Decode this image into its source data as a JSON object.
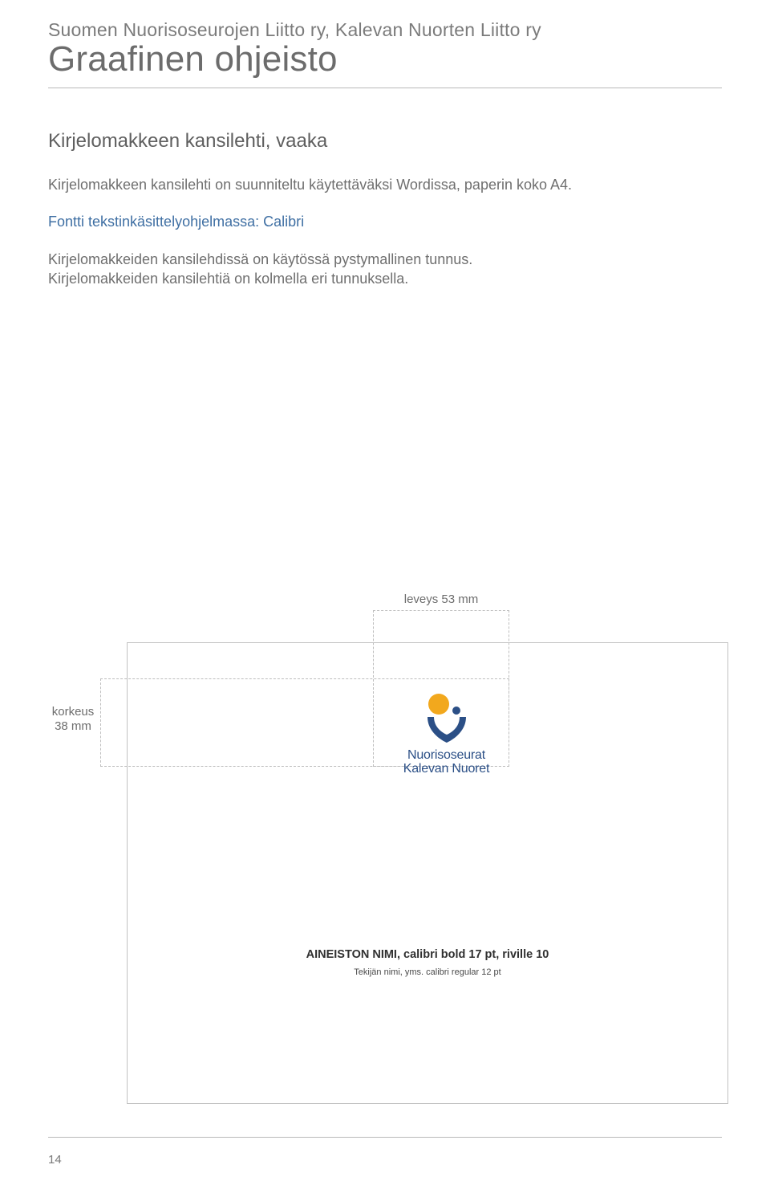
{
  "header": {
    "org": "Suomen Nuorisoseurojen Liitto ry, Kalevan Nuorten Liitto ry",
    "title": "Graafinen ohjeisto"
  },
  "section": {
    "title": "Kirjelomakkeen kansilehti, vaaka",
    "p1": "Kirjelomakkeen kansilehti on suunniteltu käytettäväksi Wordissa, paperin koko A4.",
    "p2": "Fontti tekstinkäsittelyohjelmassa: Calibri",
    "p3a": "Kirjelomakkeiden kansilehdissä on käytössä pystymallinen tunnus.",
    "p3b": "Kirjelomakkeiden kansilehtiä on kolmella eri tunnuksella."
  },
  "diagram": {
    "label_width": "leveys 53 mm",
    "label_height_l1": "korkeus",
    "label_height_l2": "38 mm",
    "logo_line1": "Nuorisoseurat",
    "logo_line2": "Kalevan Nuoret",
    "caption_main": "AINEISTON NIMI, calibri bold 17 pt, riville 10",
    "caption_sub": "Tekijän nimi, yms. calibri regular 12 pt"
  },
  "footer": {
    "page": "14"
  },
  "colors": {
    "brand_blue": "#2b4f86",
    "brand_orange": "#f2a81d",
    "link_blue": "#3f6fa3"
  }
}
